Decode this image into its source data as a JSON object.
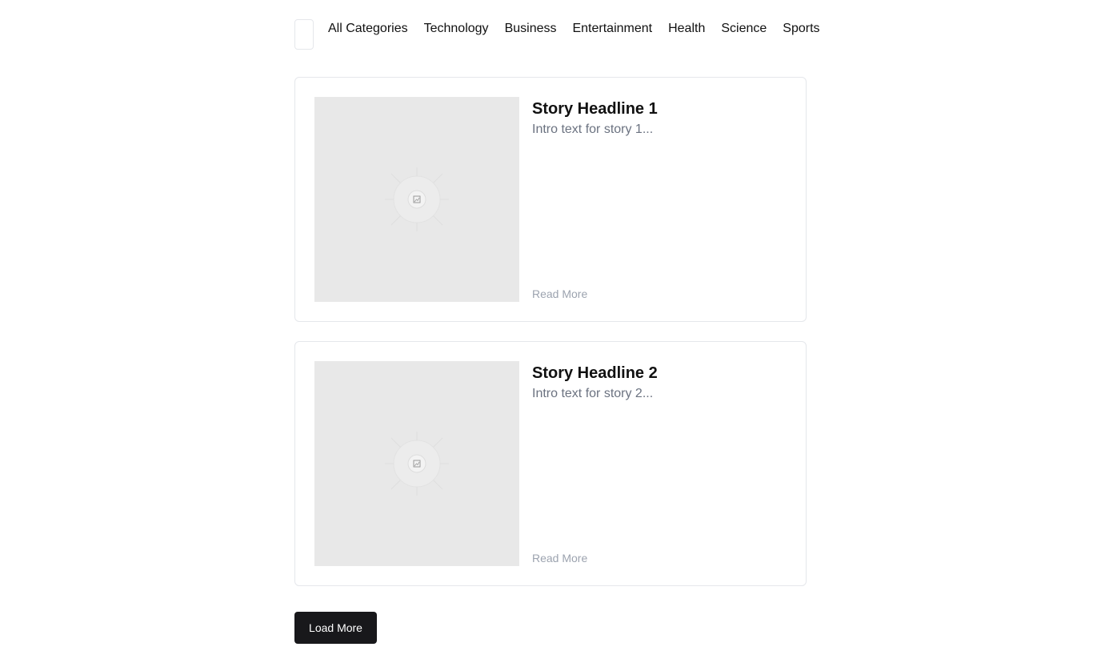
{
  "nav": {
    "menu_icon": "menu-icon",
    "categories": [
      "All Categories",
      "Technology",
      "Business",
      "Entertainment",
      "Health",
      "Science",
      "Sports"
    ]
  },
  "stories": [
    {
      "headline": "Story Headline 1",
      "intro": "Intro text for story 1...",
      "read_more": "Read More",
      "image_icon": "image-placeholder-icon"
    },
    {
      "headline": "Story Headline 2",
      "intro": "Intro text for story 2...",
      "read_more": "Read More",
      "image_icon": "image-placeholder-icon"
    }
  ],
  "load_more_label": "Load More",
  "colors": {
    "button_bg": "#18181b",
    "button_text": "#ffffff",
    "intro_text": "#6b7280",
    "read_more_text": "#9ca3af",
    "placeholder_bg": "#e8e8e8",
    "card_border": "#e5e7eb"
  }
}
